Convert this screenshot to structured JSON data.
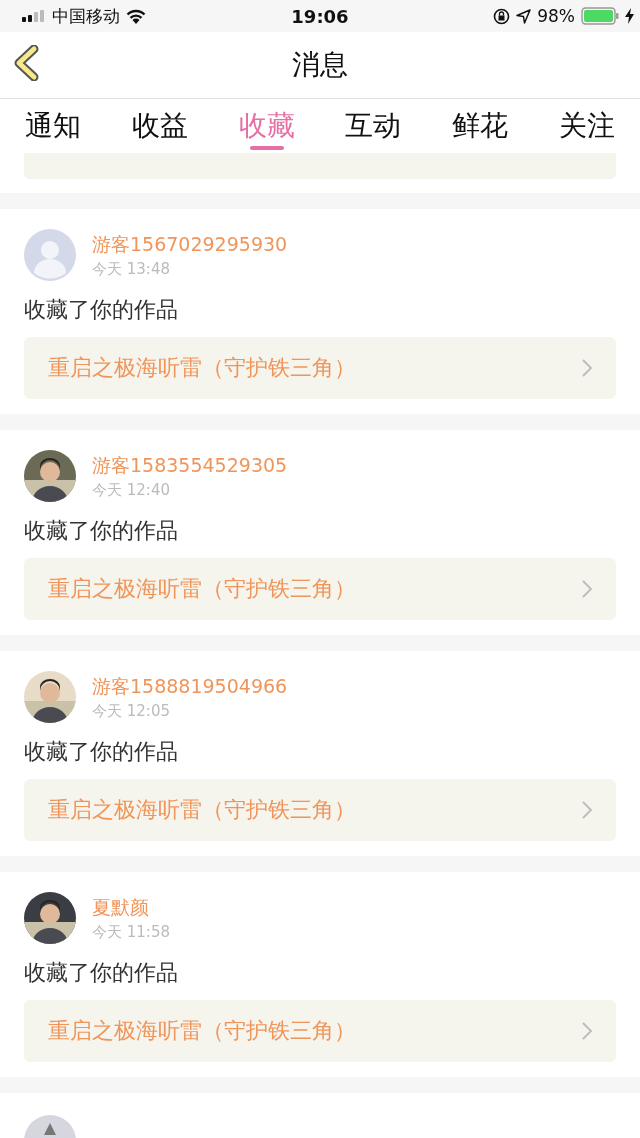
{
  "status_bar": {
    "carrier": "中国移动",
    "time": "19:06",
    "battery": "98%"
  },
  "nav": {
    "title": "消息"
  },
  "tabs": [
    {
      "label": "通知",
      "selected": false
    },
    {
      "label": "收益",
      "selected": false
    },
    {
      "label": "收藏",
      "selected": true
    },
    {
      "label": "互动",
      "selected": false
    },
    {
      "label": "鲜花",
      "selected": false
    },
    {
      "label": "关注",
      "selected": false
    }
  ],
  "messages": [
    {
      "avatar": {
        "kind": "placeholder"
      },
      "name": "游客1567029295930",
      "time": "今天 13:48",
      "text": "收藏了你的作品",
      "work": "重启之极海听雷（守护铁三角）"
    },
    {
      "name": "游客1583554529305",
      "time": "今天 12:40",
      "text": "收藏了你的作品",
      "work": "重启之极海听雷（守护铁三角）"
    },
    {
      "name": "游客1588819504966",
      "time": "今天 12:05",
      "text": "收藏了你的作品",
      "work": "重启之极海听雷（守护铁三角）"
    },
    {
      "name": "夏默颜",
      "time": "今天 11:58",
      "text": "收藏了你的作品",
      "work": "重启之极海听雷（守护铁三角）"
    }
  ]
}
